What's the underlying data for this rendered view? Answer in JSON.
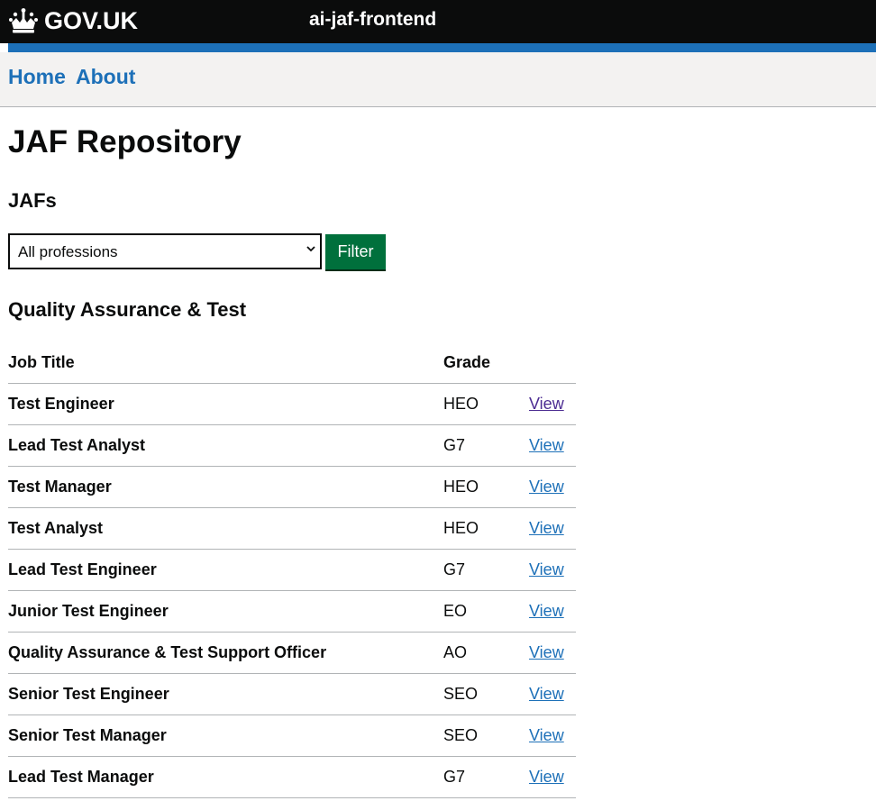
{
  "header": {
    "logo_text": "GOV.UK",
    "service_name": "ai-jaf-frontend",
    "logo_icon": "crown-icon"
  },
  "nav": {
    "items": [
      {
        "label": "Home"
      },
      {
        "label": "About"
      }
    ]
  },
  "page": {
    "title": "JAF Repository",
    "section_title": "JAFs",
    "subsection_title": "Quality Assurance & Test"
  },
  "filter": {
    "selected": "All professions",
    "button_label": "Filter"
  },
  "table": {
    "headers": {
      "title": "Job Title",
      "grade": "Grade"
    },
    "rows": [
      {
        "title": "Test Engineer",
        "grade": "HEO",
        "action": "View"
      },
      {
        "title": "Lead Test Analyst",
        "grade": "G7",
        "action": "View"
      },
      {
        "title": "Test Manager",
        "grade": "HEO",
        "action": "View"
      },
      {
        "title": "Test Analyst",
        "grade": "HEO",
        "action": "View"
      },
      {
        "title": "Lead Test Engineer",
        "grade": "G7",
        "action": "View"
      },
      {
        "title": "Junior Test Engineer",
        "grade": "EO",
        "action": "View"
      },
      {
        "title": "Quality Assurance & Test Support Officer",
        "grade": "AO",
        "action": "View"
      },
      {
        "title": "Senior Test Engineer",
        "grade": "SEO",
        "action": "View"
      },
      {
        "title": "Senior Test Manager",
        "grade": "SEO",
        "action": "View"
      },
      {
        "title": "Lead Test Manager",
        "grade": "G7",
        "action": "View"
      }
    ]
  },
  "colors": {
    "header_bg": "#0b0c0c",
    "accent_blue": "#1d70b8",
    "button_green": "#00703c",
    "nav_bg": "#f3f2f1",
    "visited_link": "#4c2c92"
  }
}
